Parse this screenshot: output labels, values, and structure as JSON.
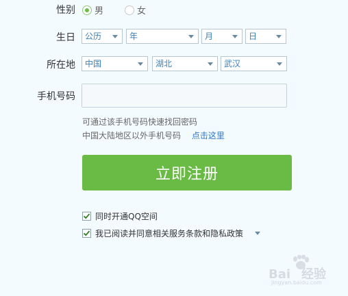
{
  "gender": {
    "label": "性别",
    "options": [
      {
        "label": "男",
        "selected": true
      },
      {
        "label": "女",
        "selected": false
      }
    ]
  },
  "birthday": {
    "label": "生日",
    "calendar": "公历",
    "year": "年",
    "month": "月",
    "day": "日"
  },
  "location": {
    "label": "所在地",
    "country": "中国",
    "province": "湖北",
    "city": "武汉"
  },
  "phone": {
    "label": "手机号码",
    "value": "",
    "hint": "可通过该手机号码快速找回密码",
    "overseas_text": "中国大陆地区以外手机号码",
    "overseas_link": "点击这里"
  },
  "submit": {
    "label": "立即注册"
  },
  "options": {
    "qzone": {
      "label": "同时开通QQ空间",
      "checked": true
    },
    "agree": {
      "label": "我已阅读并同意相关服务条款和隐私政策",
      "checked": true
    }
  },
  "watermark": {
    "brand": "Bai",
    "brand2": "经验",
    "sub": "jingyan.baidu.com"
  },
  "colors": {
    "accent_green": "#69bb45",
    "link_blue": "#2d76c6",
    "background": "#f4fbff"
  }
}
